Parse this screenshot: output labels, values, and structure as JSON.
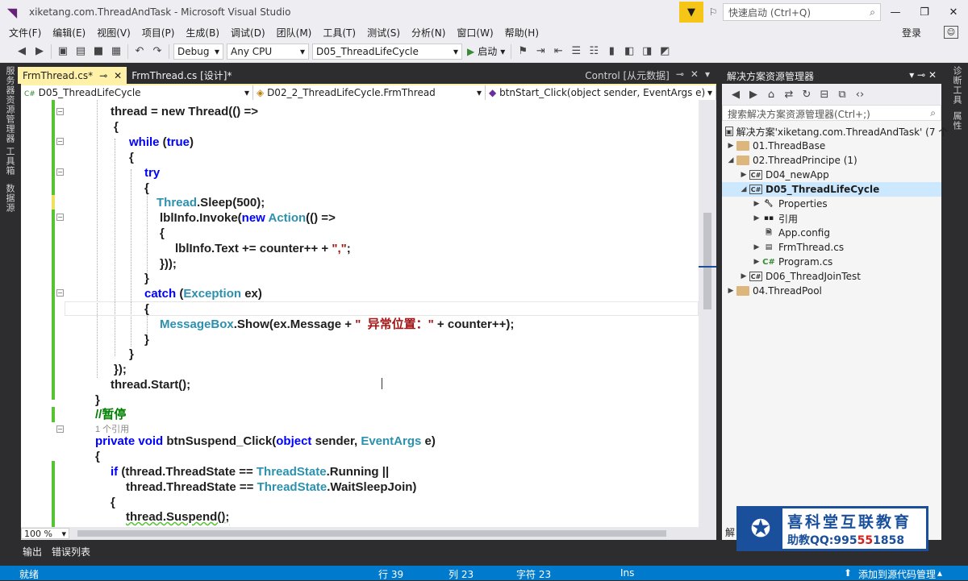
{
  "window": {
    "title": "xiketang.com.ThreadAndTask - Microsoft Visual Studio",
    "quick_launch": "快速启动 (Ctrl+Q)"
  },
  "menu": [
    "文件(F)",
    "编辑(E)",
    "视图(V)",
    "项目(P)",
    "生成(B)",
    "调试(D)",
    "团队(M)",
    "工具(T)",
    "测试(S)",
    "分析(N)",
    "窗口(W)",
    "帮助(H)"
  ],
  "login": "登录",
  "toolbar": {
    "config": "Debug",
    "platform": "Any CPU",
    "startup_project": "D05_ThreadLifeCycle",
    "start_label": "启动"
  },
  "left_strip": [
    "服务器资源管理器",
    "工具箱",
    "数据源"
  ],
  "right_strip": [
    "诊断工具",
    "属性"
  ],
  "tabs": {
    "active": "FrmThread.cs*",
    "inactive": "FrmThread.cs [设计]*",
    "right_label": "Control [从元数据]"
  },
  "nav": {
    "project": "D05_ThreadLifeCycle",
    "class": "D02_2_ThreadLifeCycle.FrmThread",
    "member": "btnStart_Click(object sender, EventArgs e)"
  },
  "code": {
    "l1": "thread = new Thread(() =>",
    "l2": "{",
    "l3": "while (true)",
    "l4": "{",
    "l5": "try",
    "l6": "{",
    "l7": "Thread.Sleep(500);",
    "l8": "lblInfo.Invoke(new Action(() =>",
    "l9": "{",
    "l10": "lblInfo.Text += counter++ + \",\";",
    "l11": "}));",
    "l12": "}",
    "l13": "catch (Exception ex)",
    "l14": "{",
    "l15": "MessageBox.Show(ex.Message + \"  异常位置：\" + counter++);",
    "l16": "}",
    "l17": "}",
    "l18": "});",
    "l19": "thread.Start();",
    "l20": "}",
    "l21": "//暂停",
    "ref": "1 个引用",
    "l22": "private void btnSuspend_Click(object sender, EventArgs e)",
    "l23": "{",
    "l24": "if (thread.ThreadState == ThreadState.Running ||",
    "l25": "thread.ThreadState == ThreadState.WaitSleepJoin)",
    "l26": "{",
    "l27": "thread.Suspend();"
  },
  "zoom": "100 %",
  "solution": {
    "title": "解决方案资源管理器",
    "search": "搜索解决方案资源管理器(Ctrl+;)",
    "items": [
      {
        "label": "解决方案'xiketang.com.ThreadAndTask' (7 个",
        "depth": 0
      },
      {
        "label": "01.ThreadBase",
        "depth": 1
      },
      {
        "label": "02.ThreadPrincipe  (1)",
        "depth": 1
      },
      {
        "label": "D04_newApp",
        "depth": 2
      },
      {
        "label": "D05_ThreadLifeCycle",
        "depth": 2
      },
      {
        "label": "Properties",
        "depth": 3
      },
      {
        "label": "引用",
        "depth": 3
      },
      {
        "label": "App.config",
        "depth": 3
      },
      {
        "label": "FrmThread.cs",
        "depth": 3
      },
      {
        "label": "Program.cs",
        "depth": 3
      },
      {
        "label": "D06_ThreadJoinTest",
        "depth": 2
      },
      {
        "label": "04.ThreadPool",
        "depth": 1
      }
    ],
    "bottom_label": "解"
  },
  "logo": {
    "line1": "喜科堂互联教育",
    "line2_prefix": "助教QQ:995",
    "line2_red": "55",
    "line2_suffix": "1858"
  },
  "output_tabs": [
    "输出",
    "错误列表"
  ],
  "status": {
    "ready": "就绪",
    "line": "行 39",
    "col": "列 23",
    "ch": "字符 23",
    "mode": "Ins",
    "source_control": "添加到源代码管理"
  }
}
